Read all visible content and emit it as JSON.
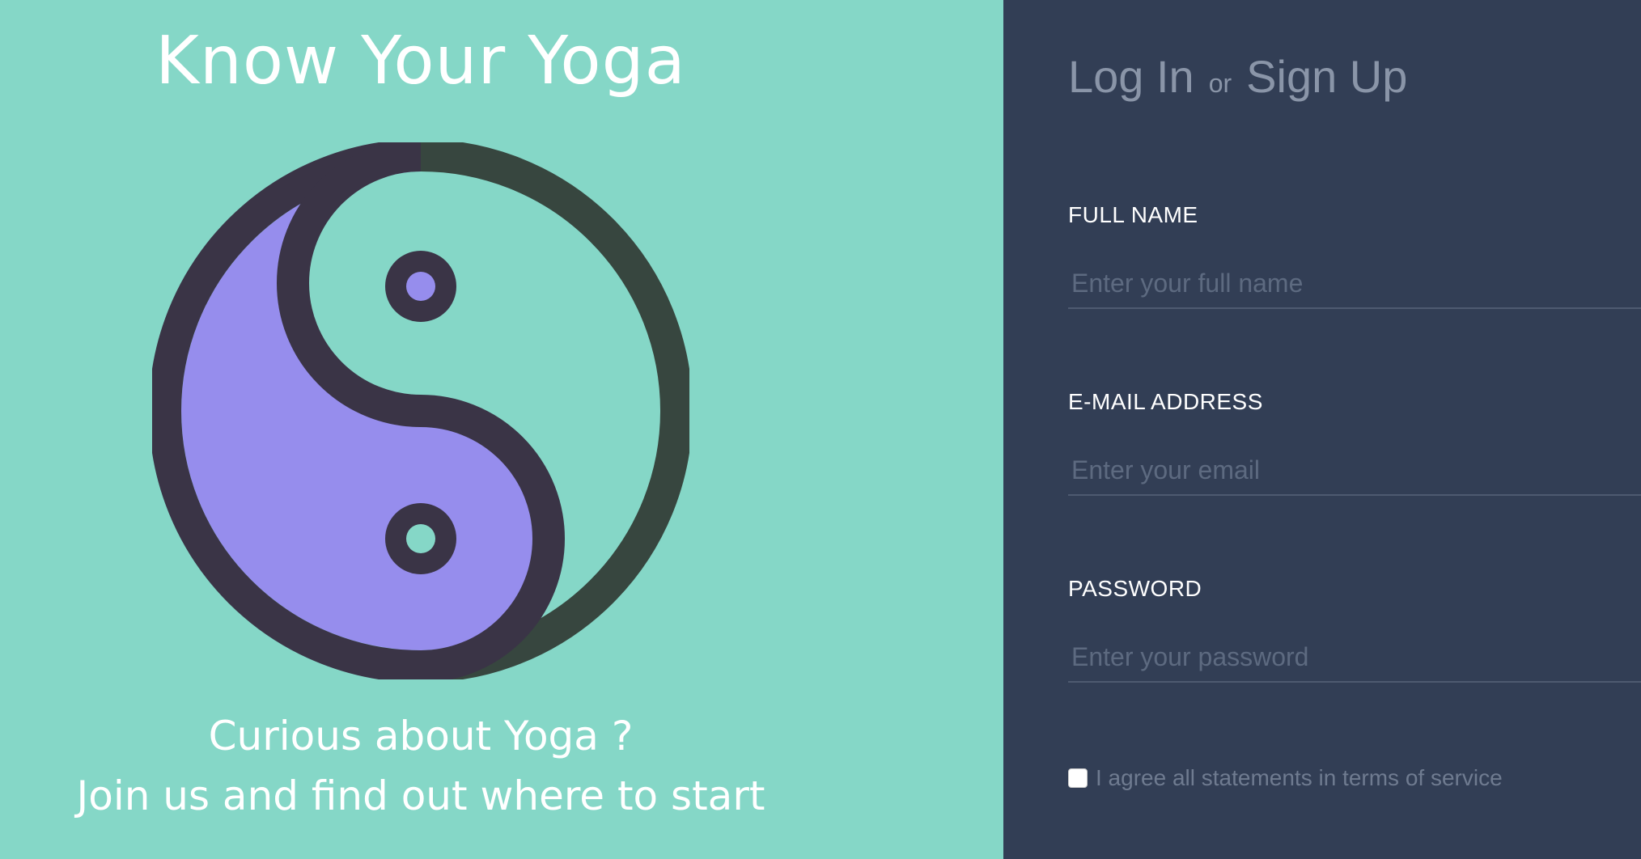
{
  "brand": {
    "title": "Know Your Yoga",
    "logo_icon": "yin-yang-icon",
    "tagline_line1": "Curious about Yoga ?",
    "tagline_line2": "Join us and find out where to start"
  },
  "auth": {
    "login_label": "Log In",
    "or_label": "or",
    "signup_label": "Sign Up"
  },
  "form": {
    "full_name": {
      "label": "FULL NAME",
      "placeholder": "Enter your full name",
      "value": ""
    },
    "email": {
      "label": "E-MAIL ADDRESS",
      "placeholder": "Enter your email",
      "value": ""
    },
    "password": {
      "label": "PASSWORD",
      "placeholder": "Enter your password",
      "value": ""
    },
    "terms": {
      "label": "I agree all statements in terms of service",
      "checked": false
    }
  },
  "colors": {
    "left_bg": "#85d7c7",
    "right_bg": "#323e55",
    "accent_purple": "#968ded",
    "logo_outline": "#3a3446"
  }
}
